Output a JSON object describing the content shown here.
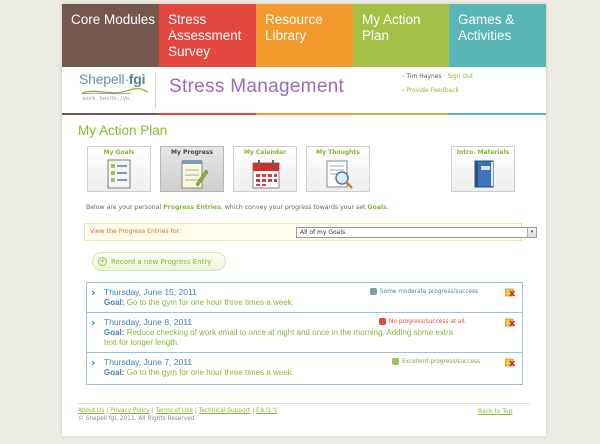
{
  "colors": {
    "core": "#74584f",
    "stress": "#e3483f",
    "resource": "#f29a2e",
    "action": "#a4c046",
    "games": "#59b6b6",
    "green": "#8ab832",
    "blue": "#3b84b8",
    "purple": "#9a6db0"
  },
  "topnav": [
    {
      "lines": [
        "Core Modules"
      ],
      "color": "#74584f"
    },
    {
      "lines": [
        "Stress",
        "Assessment",
        "Survey"
      ],
      "color": "#e3483f"
    },
    {
      "lines": [
        "Resource",
        "Library"
      ],
      "color": "#f29a2e"
    },
    {
      "lines": [
        "My Action",
        "Plan"
      ],
      "color": "#a4c046"
    },
    {
      "lines": [
        "Games &",
        "Activities"
      ],
      "color": "#59b6b6"
    }
  ],
  "header": {
    "logo_name": "Shepell",
    "logo_dot": "·",
    "logo_bold": "fgi",
    "logo_tagline": "work. health. life.",
    "app_title": "Stress Management",
    "user_name": "Tim Haynes",
    "sign_out": "Sign Out",
    "provide_feedback": "Provide Feedback"
  },
  "page_title": "My Action Plan",
  "tiles": [
    {
      "label": "My Goals",
      "icon": "goals-checklist-icon",
      "active": false
    },
    {
      "label": "My Progress",
      "icon": "progress-notepad-icon",
      "active": true
    },
    {
      "label": "My Calendar",
      "icon": "calendar-icon",
      "active": false
    },
    {
      "label": "My Thoughts",
      "icon": "thoughts-magnifier-icon",
      "active": false
    },
    {
      "label": "Intro. Materials",
      "icon": "intro-book-icon",
      "active": false
    }
  ],
  "intro": {
    "before": "Below are your personal ",
    "highlight1": "Progress Entries",
    "middle": ", which convey your progress towards your set ",
    "highlight2": "Goals",
    "after": "."
  },
  "filter": {
    "label": "View the Progress Entries for:",
    "selected": "All of my Goals."
  },
  "record_button": "Record a new Progress Entry",
  "entries": [
    {
      "date": "Thursday, June 15, 2011",
      "goal_label": "Goal:",
      "goal": "Go to the gym for one hour three times a week.",
      "status": "Some moderate progress/success",
      "status_color": "#3b84b8",
      "status_icon": "moderate-face-icon"
    },
    {
      "date": "Thursday, June 8, 2011",
      "goal_label": "Goal:",
      "goal": "Reduce checking of work email to once at night and once in the morning. Adding some extra text for longer length.",
      "status": "No progress/success at all.",
      "status_color": "#e3483f",
      "status_icon": "no-progress-face-icon"
    },
    {
      "date": "Thursday, June 7, 2011",
      "goal_label": "Goal:",
      "goal": "Go to the gym for one hour three times a week.",
      "status": "Excellent progress/success",
      "status_color": "#7aa43a",
      "status_icon": "excellent-face-icon"
    }
  ],
  "footer": {
    "links": [
      "About Us",
      "Privacy Policy",
      "Terms of Use",
      "Technical Support",
      "F.A.Q.'s"
    ],
    "copyright": "© Shepell·fgi, 2011. All Rights Reserved",
    "back_to_top": "Back to Top"
  }
}
